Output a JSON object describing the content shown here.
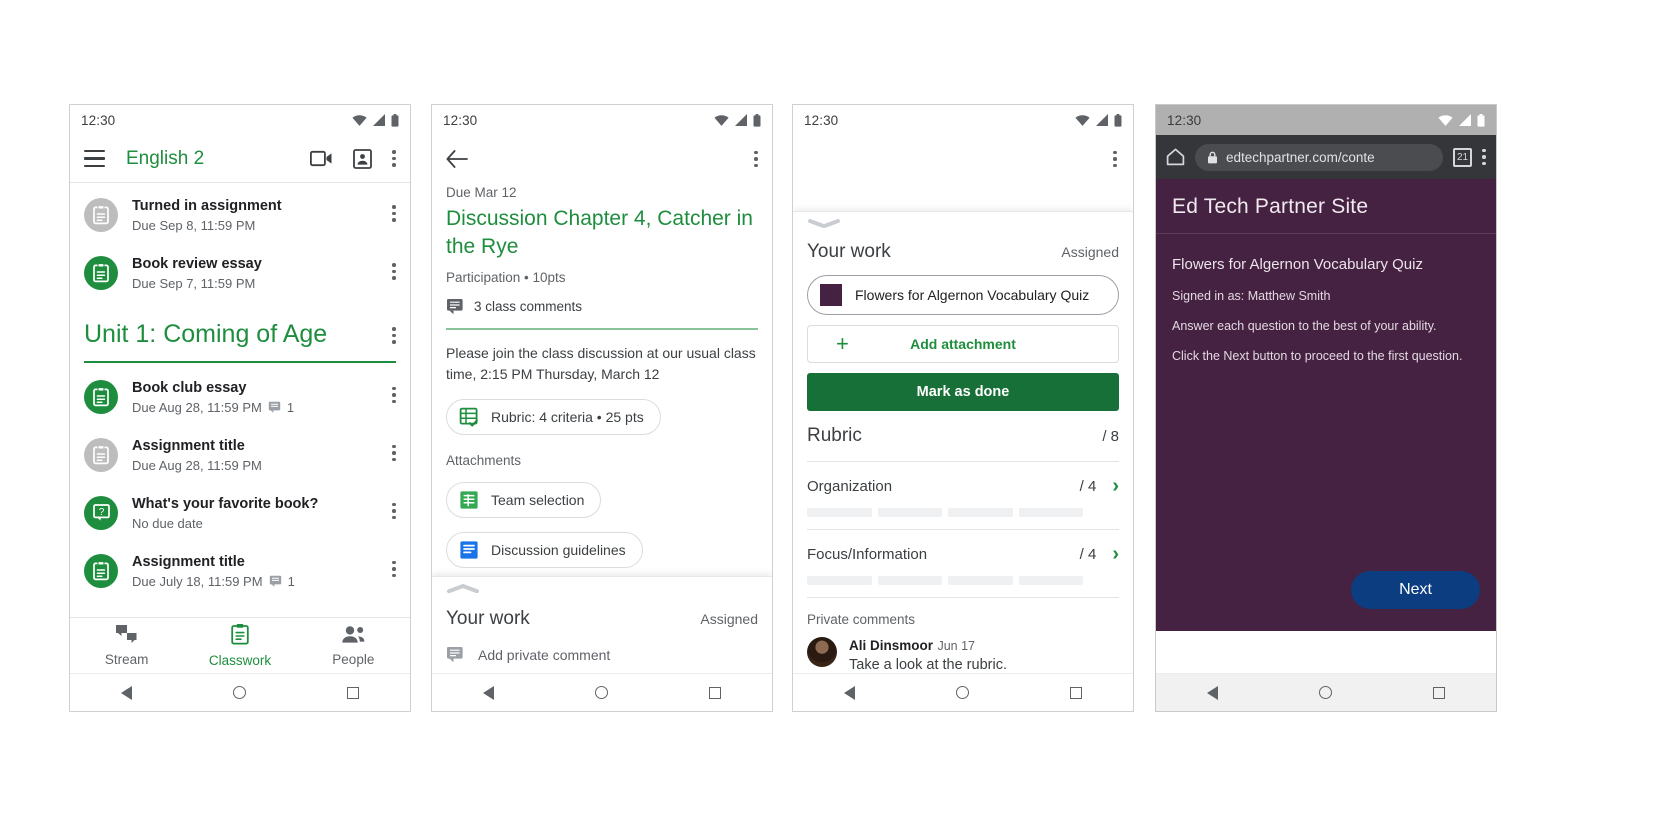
{
  "phone1": {
    "status": {
      "time": "12:30"
    },
    "appbar": {
      "title": "English 2",
      "menu_icon": "hamburger-icon",
      "video_icon": "video-camera-icon",
      "card_icon": "class-card-icon",
      "overflow_icon": "overflow-menu-icon"
    },
    "top_items": [
      {
        "title": "Turned in assignment",
        "subtitle": "Due Sep 8, 11:59 PM",
        "state": "turned-in",
        "attachments": ""
      },
      {
        "title": "Book review essay",
        "subtitle": "Due Sep 7, 11:59 PM",
        "state": "assigned",
        "attachments": ""
      }
    ],
    "unit": {
      "title": "Unit 1: Coming of Age"
    },
    "unit_items": [
      {
        "title": "Book club essay",
        "subtitle": "Due Aug 28, 11:59 PM",
        "state": "assigned",
        "attachments": "1",
        "icon": "assignment-icon"
      },
      {
        "title": "Assignment title",
        "subtitle": "Due Aug 28, 11:59 PM",
        "state": "turned-in",
        "attachments": "",
        "icon": "assignment-icon"
      },
      {
        "title": "What's your favorite book?",
        "subtitle": "No due date",
        "state": "assigned",
        "attachments": "",
        "icon": "question-icon"
      },
      {
        "title": "Assignment title",
        "subtitle": "Due July 18, 11:59 PM",
        "state": "assigned",
        "attachments": "1",
        "icon": "assignment-icon"
      }
    ],
    "tabs": [
      {
        "label": "Stream",
        "icon": "stream-icon",
        "active": false
      },
      {
        "label": "Classwork",
        "icon": "classwork-icon",
        "active": true
      },
      {
        "label": "People",
        "icon": "people-icon",
        "active": false
      }
    ]
  },
  "phone2": {
    "status": {
      "time": "12:30"
    },
    "appbar": {
      "back_icon": "back-arrow-icon",
      "overflow_icon": "overflow-menu-icon"
    },
    "due": "Due Mar 12",
    "title": "Discussion Chapter 4, Catcher in the Rye",
    "meta": "Participation • 10pts",
    "comments": "3 class comments",
    "description": "Please join the class discussion at our usual class time, 2:15 PM Thursday, March 12",
    "rubric_chip": "Rubric: 4 criteria • 25 pts",
    "attachments_label": "Attachments",
    "attachments": [
      {
        "label": "Team selection",
        "type": "sheets"
      },
      {
        "label": "Discussion guidelines",
        "type": "docs"
      }
    ],
    "sheet": {
      "title": "Your work",
      "status": "Assigned",
      "private_comment_placeholder": "Add private comment"
    }
  },
  "phone3": {
    "status": {
      "time": "12:30"
    },
    "appbar": {
      "overflow_icon": "overflow-menu-icon"
    },
    "work": {
      "title": "Your work",
      "status": "Assigned"
    },
    "attachment": {
      "label": "Flowers for Algernon Vocabulary Quiz",
      "thumb_color": "#452241"
    },
    "add_attachment": "Add attachment",
    "mark_as_done": "Mark as done",
    "rubric": {
      "title": "Rubric",
      "total_score": "/ 8",
      "criteria": [
        {
          "name": "Organization",
          "score": "/ 4",
          "levels": 4
        },
        {
          "name": "Focus/Information",
          "score": "/ 4",
          "levels": 4
        }
      ]
    },
    "private_comments": {
      "label": "Private comments",
      "items": [
        {
          "author": "Ali Dinsmoor",
          "date": "Jun 17",
          "text": "Take a look at the rubric."
        }
      ]
    }
  },
  "phone4": {
    "status": {
      "time": "12:30"
    },
    "chrome": {
      "home_icon": "home-icon",
      "lock_icon": "lock-icon",
      "url": "edtechpartner.com/conte",
      "tab_count": "21",
      "overflow_icon": "overflow-menu-icon"
    },
    "site_title": "Ed Tech Partner Site",
    "quiz_title": "Flowers for Algernon Vocabulary Quiz",
    "lines": [
      "Signed in as: Matthew Smith",
      "Answer each question to the best of your ability.",
      "Click the Next button to proceed to the first question."
    ],
    "next_button": "Next",
    "colors": {
      "page_bg": "#452241",
      "next_bg": "#0b3d80"
    }
  },
  "nav": {
    "back_icon": "nav-back-icon",
    "home_icon": "nav-home-icon",
    "recents_icon": "nav-recents-icon"
  },
  "theme": {
    "green": "#1e8e3e",
    "dark_green": "#177038",
    "grey": "#5f6368"
  }
}
